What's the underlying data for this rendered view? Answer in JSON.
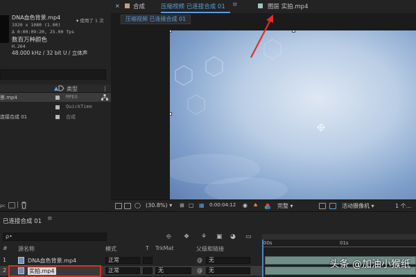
{
  "project": {
    "footage_name": "DNA血色背景.mp4",
    "used_label": "使用了 1 次",
    "meta": {
      "resolution": "1920 x 1080 (1.00)",
      "duration_fps": "Δ 0:00:09:20, 25.00 fps",
      "colors": "数百万种颜色",
      "codec": "H.264",
      "audio": "48.000 kHz / 32 bit U / 立体声"
    },
    "columns": {
      "type": "类型"
    },
    "items": [
      {
        "name": "景.mp4",
        "type": "MPEG",
        "color": "#b8b8b8"
      },
      {
        "name": "",
        "type": "QuickTime",
        "color": "#b8b8b8"
      },
      {
        "name": "连接合成 01",
        "type": "合成",
        "color": "#b8b8b8"
      }
    ],
    "bpc": "pc"
  },
  "comp": {
    "tab_prefix": "合成",
    "tab_name": "压缩视频 已连接合成 01",
    "layer_tab": "图层 实拍.mp4",
    "sub_tab": "压缩视频 已连接合成 01",
    "zoom": "(30.8%)",
    "timecode": "0:00:04:12",
    "quality": "完整",
    "camera": "活动摄像机",
    "views": "1 个...",
    "annotation_color": "#e0301e"
  },
  "timeline": {
    "tab_name": "已连接合成 01",
    "search_placeholder": "ρ•",
    "columns": {
      "num": "#",
      "name": "源名称",
      "mode": "模式",
      "t": "T",
      "trkmat": "TrkMat",
      "parent": "父级和链接"
    },
    "ruler": [
      "00s",
      "01s"
    ],
    "layers": [
      {
        "num": "1",
        "name": "DNA血色背景.mp4",
        "mode": "正常",
        "trkmat": "",
        "parent": "无"
      },
      {
        "num": "2",
        "name": "实拍.mp4",
        "mode": "正常",
        "trkmat": "无",
        "parent": "无"
      }
    ],
    "highlight_color": "#e0301e"
  },
  "watermark": "头条 @加油小猴纸"
}
